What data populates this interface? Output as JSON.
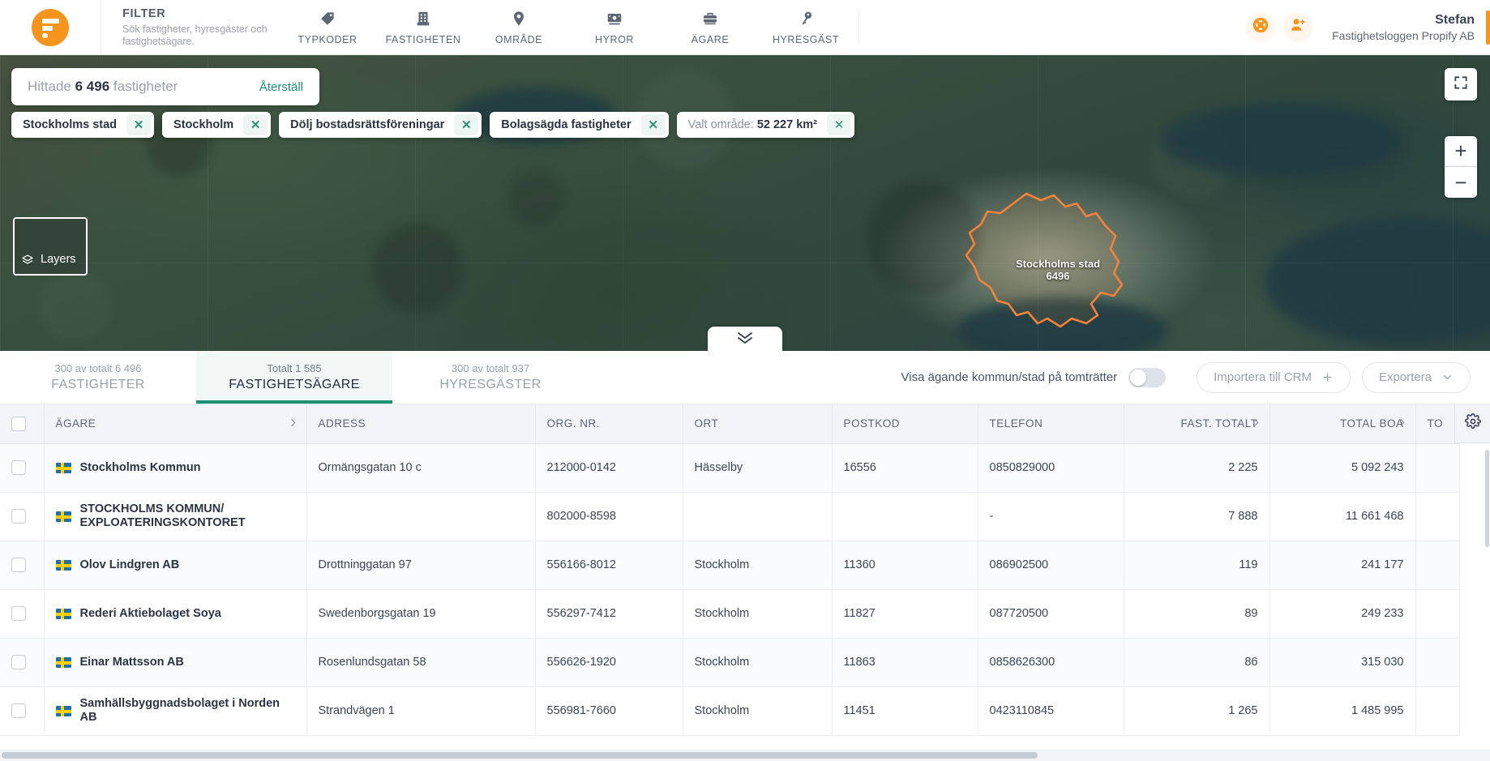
{
  "topnav": {
    "logo": "propify-logo",
    "filter": {
      "title": "FILTER",
      "subtitle": "Sök fastigheter, hyresgäster och fastighetsägare."
    },
    "items": [
      {
        "label": "TYPKODER",
        "icon": "tag-icon"
      },
      {
        "label": "FASTIGHETEN",
        "icon": "building-icon"
      },
      {
        "label": "OMRÅDE",
        "icon": "map-pin-icon"
      },
      {
        "label": "HYROR",
        "icon": "money-icon"
      },
      {
        "label": "ÄGARE",
        "icon": "briefcase-icon"
      },
      {
        "label": "HYRESGÄST",
        "icon": "key-icon"
      }
    ],
    "actions": [
      {
        "name": "support-icon",
        "glyph": "lifebuoy"
      },
      {
        "name": "add-user-icon",
        "glyph": "user-plus"
      }
    ],
    "user": {
      "name": "Stefan",
      "company": "Fastighetsloggen Propify AB"
    },
    "accent": "#f7941e"
  },
  "map": {
    "search": {
      "prefix": "Hittade",
      "count": "6 496",
      "suffix": "fastigheter",
      "reset_label": "Återställ",
      "placeholder": "Hittade 6 496 fastigheter"
    },
    "chips": [
      {
        "label": "Stockholms stad",
        "muted": false
      },
      {
        "label": "Stockholm",
        "muted": false
      },
      {
        "label": "Dölj bostadsrättsföreningar",
        "muted": false
      },
      {
        "label": "Bolagsägda fastigheter",
        "muted": false
      },
      {
        "label": "Valt område:",
        "value": "52 227 km²",
        "muted": true
      }
    ],
    "region_label": {
      "name": "Stockholms stad",
      "count": "6496"
    },
    "layers_label": "Layers",
    "controls": {
      "fullscreen": "fullscreen-icon",
      "zoom_in": "+",
      "zoom_out": "−"
    }
  },
  "tabs": [
    {
      "count": "300 av totalt 6 496",
      "name": "FASTIGHETER",
      "active": false
    },
    {
      "count": "Totalt 1 585",
      "name": "FASTIGHETSÄGARE",
      "active": true
    },
    {
      "count": "300 av totalt 937",
      "name": "HYRESGÄSTER",
      "active": false
    }
  ],
  "toolbar": {
    "toggle_label": "Visa ägande kommun/stad på tomträtter",
    "toggle_on": false,
    "import_label": "Importera till CRM",
    "export_label": "Exportera"
  },
  "table": {
    "columns": [
      {
        "label": "ÄGARE",
        "sortable": true,
        "align": "left"
      },
      {
        "label": "ADRESS",
        "sortable": false,
        "align": "left"
      },
      {
        "label": "ORG. NR.",
        "sortable": false,
        "align": "left"
      },
      {
        "label": "ORT",
        "sortable": false,
        "align": "left"
      },
      {
        "label": "POSTKOD",
        "sortable": false,
        "align": "left"
      },
      {
        "label": "TELEFON",
        "sortable": false,
        "align": "left"
      },
      {
        "label": "FAST. TOTALT",
        "sortable": true,
        "align": "right"
      },
      {
        "label": "TOTAL BOA",
        "sortable": true,
        "align": "right"
      },
      {
        "label": "TO",
        "sortable": false,
        "align": "right"
      }
    ],
    "rows": [
      {
        "owner": "Stockholms Kommun",
        "adress": "Ormängsgatan 10 c",
        "orgnr": "212000-0142",
        "ort": "Hässelby",
        "postkod": "16556",
        "telefon": "0850829000",
        "fast_totalt": "2 225",
        "total_boa": "5 092 243",
        "extra": ""
      },
      {
        "owner": "STOCKHOLMS KOMMUN/ EXPLOATERINGSKONTORET",
        "adress": "",
        "orgnr": "802000-8598",
        "ort": "",
        "postkod": "",
        "telefon": "-",
        "fast_totalt": "7 888",
        "total_boa": "11 661 468",
        "extra": ""
      },
      {
        "owner": "Olov Lindgren AB",
        "adress": "Drottninggatan 97",
        "orgnr": "556166-8012",
        "ort": "Stockholm",
        "postkod": "11360",
        "telefon": "086902500",
        "fast_totalt": "119",
        "total_boa": "241 177",
        "extra": ""
      },
      {
        "owner": "Rederi Aktiebolaget Soya",
        "adress": "Swedenborgsgatan 19",
        "orgnr": "556297-7412",
        "ort": "Stockholm",
        "postkod": "11827",
        "telefon": "087720500",
        "fast_totalt": "89",
        "total_boa": "249 233",
        "extra": ""
      },
      {
        "owner": "Einar Mattsson AB",
        "adress": "Rosenlundsgatan 58",
        "orgnr": "556626-1920",
        "ort": "Stockholm",
        "postkod": "11863",
        "telefon": "0858626300",
        "fast_totalt": "86",
        "total_boa": "315 030",
        "extra": ""
      },
      {
        "owner": "Samhällsbyggnadsbolaget i Norden AB",
        "adress": "Strandvägen 1",
        "orgnr": "556981-7660",
        "ort": "Stockholm",
        "postkod": "11451",
        "telefon": "0423110845",
        "fast_totalt": "1 265",
        "total_boa": "1 485 995",
        "extra": ""
      }
    ],
    "settings_icon": "gear-icon"
  }
}
